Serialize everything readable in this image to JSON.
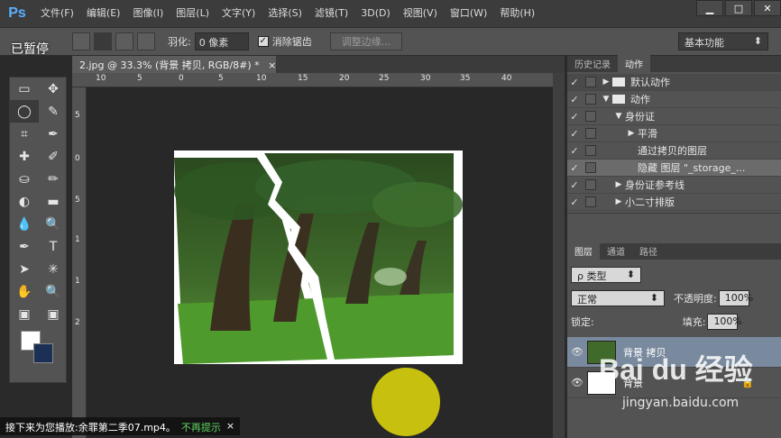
{
  "app": {
    "logo": "Ps"
  },
  "menu": [
    "文件(F)",
    "编辑(E)",
    "图像(I)",
    "图层(L)",
    "文字(Y)",
    "选择(S)",
    "滤镜(T)",
    "3D(D)",
    "视图(V)",
    "窗口(W)",
    "帮助(H)"
  ],
  "window_controls": {
    "minimize": "▁",
    "maximize": "□",
    "close": "✕"
  },
  "overlay": {
    "paused": "已暂停"
  },
  "options": {
    "feather_label": "羽化:",
    "feather_value": "0 像素",
    "antialias_label": "消除锯齿",
    "antialias_checked": "✓",
    "refine_edge": "调整边缘...",
    "workspace": "基本功能",
    "workspace_arrow": "⬍"
  },
  "document": {
    "tab_title": "2.jpg @ 33.3% (背景 拷贝, RGB/8#) *",
    "tab_close": "×",
    "ruler_top": [
      "10",
      "5",
      "0",
      "5",
      "10",
      "15",
      "20",
      "25",
      "30",
      "35",
      "40"
    ],
    "ruler_left": [
      "5",
      "0",
      "5",
      "1",
      "1",
      "2"
    ]
  },
  "tools": [
    "▭",
    "✥",
    "◯",
    "✎",
    "⌗",
    "✒",
    "✚",
    "✐",
    "⛀",
    "✏",
    "◐",
    "▬",
    "💧",
    "🔍",
    "✒",
    "T",
    "➤",
    "✳",
    "✋",
    "🔍",
    "▣",
    "▣"
  ],
  "actions_panel": {
    "tabs": [
      "历史记录",
      "动作"
    ],
    "rows": [
      {
        "check": "✓",
        "dialog": "",
        "tri": "▶",
        "folder": true,
        "indent": 0,
        "label": "默认动作"
      },
      {
        "check": "✓",
        "dialog": "",
        "tri": "▼",
        "folder": true,
        "indent": 0,
        "label": "动作"
      },
      {
        "check": "✓",
        "dialog": "",
        "tri": "▼",
        "folder": false,
        "indent": 1,
        "label": "身份证"
      },
      {
        "check": "✓",
        "dialog": "",
        "tri": "▶",
        "folder": false,
        "indent": 2,
        "label": "平滑"
      },
      {
        "check": "✓",
        "dialog": "",
        "tri": "",
        "folder": false,
        "indent": 2,
        "label": "通过拷贝的图层"
      },
      {
        "check": "✓",
        "dialog": "",
        "tri": "",
        "folder": false,
        "indent": 2,
        "label": "隐藏 图层 \"_storage_..."
      },
      {
        "check": "✓",
        "dialog": "",
        "tri": "▶",
        "folder": false,
        "indent": 1,
        "label": "身份证参考线"
      },
      {
        "check": "✓",
        "dialog": "",
        "tri": "▶",
        "folder": false,
        "indent": 1,
        "label": "小二寸排版"
      }
    ]
  },
  "layers_panel": {
    "tabs": [
      "图层",
      "通道",
      "路径"
    ],
    "filter": "ρ 类型",
    "blend_mode": "正常",
    "opacity_label": "不透明度:",
    "opacity_value": "100%",
    "lock_label": "锁定:",
    "fill_label": "填充:",
    "fill_value": "100%",
    "layers": [
      {
        "name": "背景 拷贝",
        "visible": "👁",
        "selected": true
      },
      {
        "name": "背景",
        "visible": "👁",
        "selected": false,
        "locked": "🔒"
      }
    ]
  },
  "notification": {
    "text": "接下来为您播放:余罪第二季07.mp4。",
    "link": "不再提示",
    "close": "×"
  },
  "watermark": {
    "brand": "Bai du 经验",
    "url": "jingyan.baidu.com"
  }
}
